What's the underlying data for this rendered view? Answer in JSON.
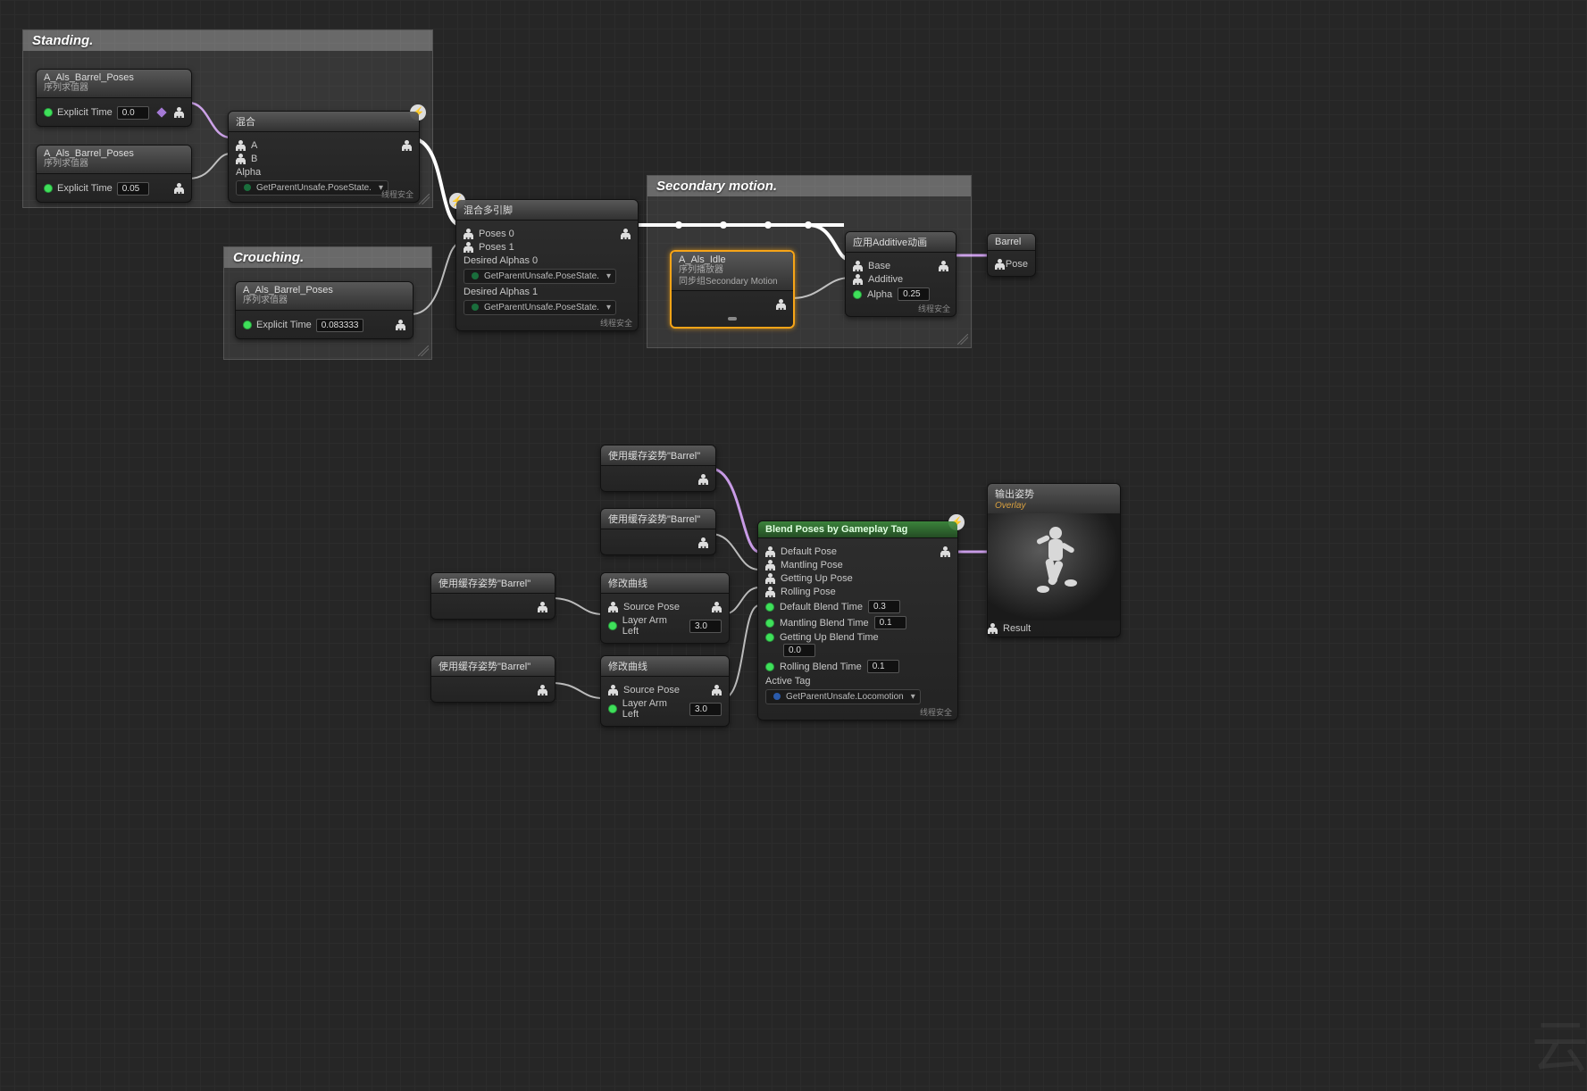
{
  "comments": {
    "standing": "Standing.",
    "crouching": "Crouching.",
    "secondary": "Secondary motion."
  },
  "nodes": {
    "poses1": {
      "title": "A_Als_Barrel_Poses",
      "sub": "序列求值器",
      "explicit_label": "Explicit Time",
      "explicit_val": "0.0"
    },
    "poses2": {
      "title": "A_Als_Barrel_Poses",
      "sub": "序列求值器",
      "explicit_label": "Explicit Time",
      "explicit_val": "0.05"
    },
    "poses3": {
      "title": "A_Als_Barrel_Poses",
      "sub": "序列求值器",
      "explicit_label": "Explicit Time",
      "explicit_val": "0.083333"
    },
    "blend": {
      "title": "混合",
      "a": "A",
      "b": "B",
      "alpha": "Alpha",
      "dd": "GetParentUnsafe.PoseState.",
      "footer": "线程安全"
    },
    "multiblend": {
      "title": "混合多引脚",
      "p0": "Poses 0",
      "p1": "Poses 1",
      "da0": "Desired Alphas 0",
      "da1": "Desired Alphas 1",
      "dd": "GetParentUnsafe.PoseState.",
      "footer": "线程安全"
    },
    "idle": {
      "title": "A_Als_Idle",
      "sub1": "序列播放器",
      "sub2": "同步组Secondary Motion"
    },
    "additive": {
      "title": "应用Additive动画",
      "base": "Base",
      "add": "Additive",
      "alpha": "Alpha",
      "alpha_val": "0.25",
      "footer": "线程安全"
    },
    "barrel": {
      "title": "Barrel",
      "pin": "Pose"
    },
    "cache": {
      "title": "使用缓存姿势\"Barrel\""
    },
    "modcurve": {
      "title": "修改曲线",
      "src": "Source Pose",
      "layer": "Layer Arm Left",
      "layer_val": "3.0"
    },
    "blendtag": {
      "title": "Blend Poses by Gameplay Tag",
      "def": "Default Pose",
      "mant": "Mantling Pose",
      "get": "Getting Up Pose",
      "roll": "Rolling Pose",
      "defbt": "Default Blend Time",
      "defbt_v": "0.3",
      "mantbt": "Mantling Blend Time",
      "mantbt_v": "0.1",
      "getbt": "Getting Up Blend Time",
      "getbt_v": "0.0",
      "rollbt": "Rolling Blend Time",
      "rollbt_v": "0.1",
      "active": "Active Tag",
      "dd": "GetParentUnsafe.Locomotion",
      "footer": "线程安全"
    },
    "output": {
      "title": "输出姿势",
      "sub": "Overlay",
      "pin": "Result"
    }
  },
  "watermark": "云"
}
